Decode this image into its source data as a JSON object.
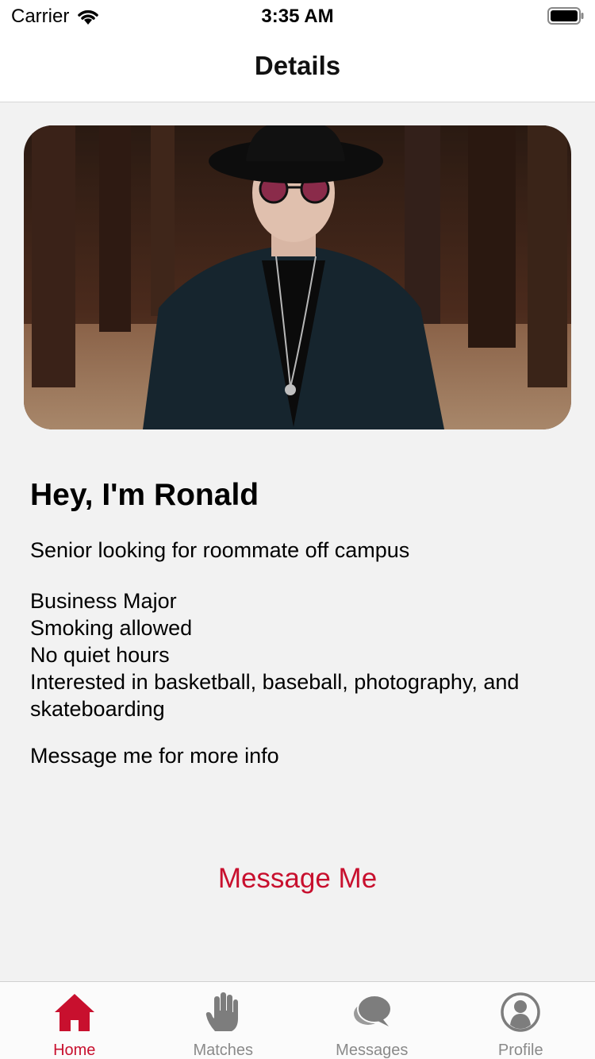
{
  "status_bar": {
    "carrier": "Carrier",
    "time": "3:35 AM"
  },
  "nav": {
    "title": "Details"
  },
  "profile": {
    "heading": "Hey, I'm Ronald",
    "tagline": "Senior looking for roommate off campus",
    "details": [
      "Business Major",
      "Smoking allowed",
      "No quiet hours",
      "Interested in basketball, baseball, photography, and skateboarding"
    ],
    "note": "Message me for more info",
    "message_button": "Message Me"
  },
  "tabs": [
    {
      "label": "Home",
      "icon": "home-icon",
      "active": true
    },
    {
      "label": "Matches",
      "icon": "hand-icon",
      "active": false
    },
    {
      "label": "Messages",
      "icon": "chat-bubble-icon",
      "active": false
    },
    {
      "label": "Profile",
      "icon": "person-icon",
      "active": false
    }
  ],
  "colors": {
    "accent": "#c8102e",
    "inactive": "#8a8a8a",
    "background": "#f2f2f2"
  }
}
